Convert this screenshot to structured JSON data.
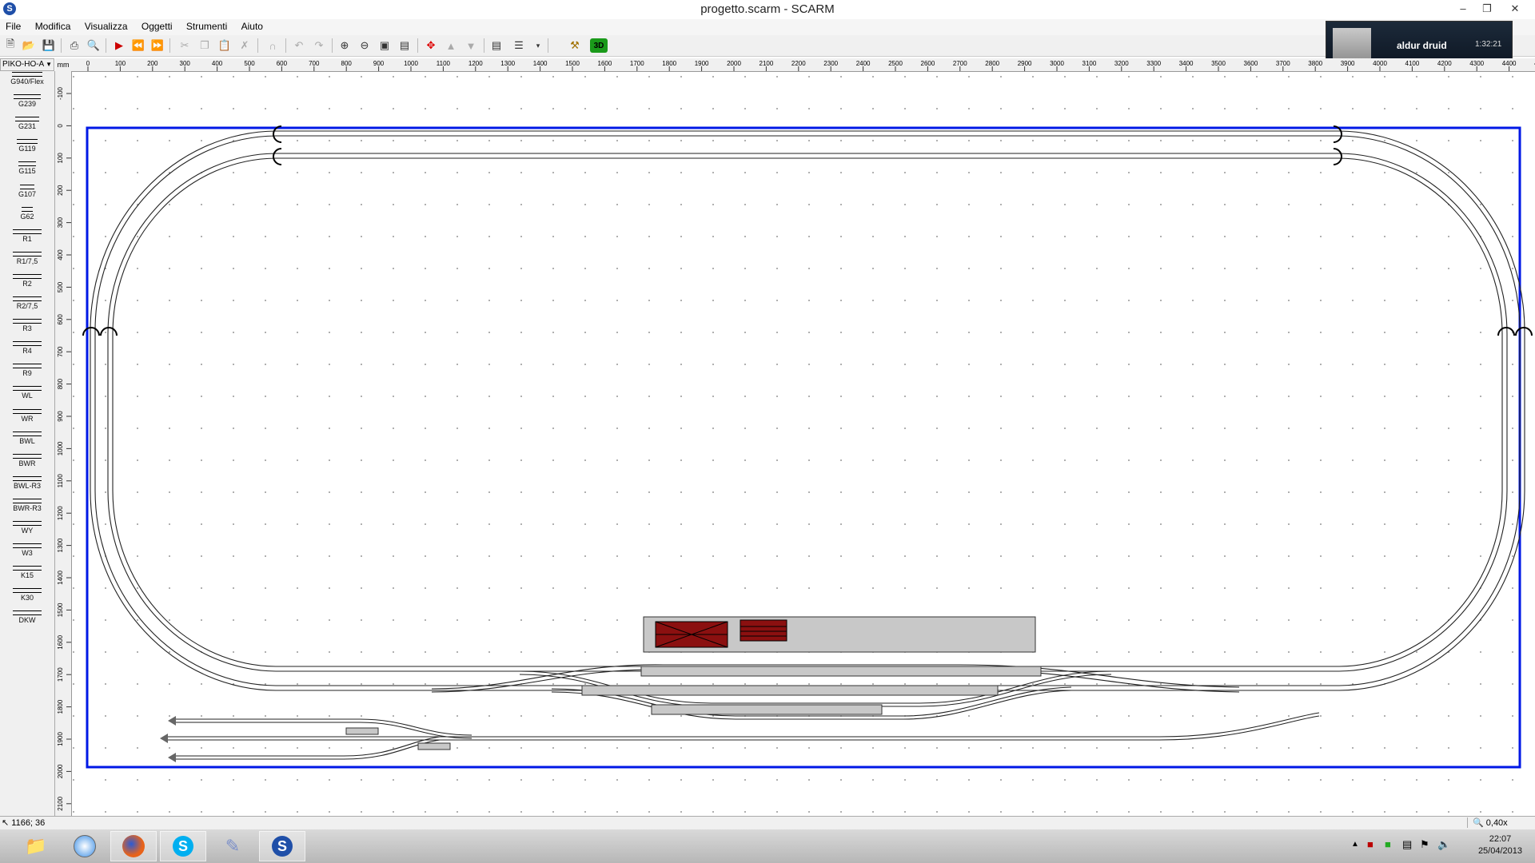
{
  "window": {
    "title": "progetto.scarm - SCARM",
    "app_icon": "S"
  },
  "menu": [
    "File",
    "Modifica",
    "Visualizza",
    "Oggetti",
    "Strumenti",
    "Aiuto"
  ],
  "toolbar_icons": [
    "new-file-icon",
    "open-folder-icon",
    "save-icon",
    "print-icon",
    "print-preview-icon",
    "run-icon",
    "rewind-icon",
    "fast-forward-icon",
    "cut-icon",
    "copy-icon",
    "paste-icon",
    "delete-icon",
    "magnet-icon",
    "undo-icon",
    "redo-icon",
    "zoom-in-icon",
    "zoom-out-icon",
    "zoom-fit-icon",
    "zoom-window-icon",
    "track-flex-icon",
    "bridge-icon",
    "tunnel-icon",
    "level-icon",
    "layers-icon",
    "tools-icon"
  ],
  "toolbar_3d_label": "3D",
  "notification": {
    "name": "aldur druid",
    "time": "1:32:21"
  },
  "library": {
    "selected": "PIKO-HO-A"
  },
  "palette_items": [
    "G940/Flex",
    "G239",
    "G231",
    "G119",
    "G115",
    "G107",
    "G62",
    "R1",
    "R1/7,5",
    "R2",
    "R2/7,5",
    "R3",
    "R4",
    "R9",
    "WL",
    "WR",
    "BWL",
    "BWR",
    "BWL-R3",
    "BWR-R3",
    "WY",
    "W3",
    "K15",
    "K30",
    "DKW"
  ],
  "ruler": {
    "unit": "mm",
    "h_labels": [
      "0",
      "100",
      "200",
      "300",
      "400",
      "500",
      "600",
      "700",
      "800",
      "900",
      "1000",
      "1100",
      "1200",
      "1300",
      "1400",
      "1500",
      "1600",
      "1700",
      "1800",
      "1900",
      "2000",
      "2100",
      "2200",
      "2300",
      "2400",
      "2500",
      "2600",
      "2700",
      "2800",
      "2900",
      "3000",
      "3100",
      "3200",
      "3300",
      "3400",
      "3500",
      "3600",
      "3700",
      "3800",
      "3900",
      "4000",
      "4100",
      "4200",
      "4300",
      "4400",
      "4500"
    ],
    "v_labels": [
      "-100",
      "0",
      "100",
      "200",
      "300",
      "400",
      "500",
      "600",
      "700",
      "800",
      "900",
      "1000",
      "1100",
      "1200",
      "1300",
      "1400",
      "1500",
      "1600",
      "1700",
      "1800",
      "1900",
      "2000",
      "2100"
    ]
  },
  "status": {
    "coords": "1166; 36",
    "zoom": "0,40x"
  },
  "taskbar": {
    "apps": [
      "file-explorer-icon",
      "safari-icon",
      "firefox-icon",
      "skype-icon",
      "paint-icon",
      "scarm-icon"
    ]
  },
  "clock": {
    "time": "22:07",
    "date": "25/04/2013"
  },
  "colors": {
    "board_border": "#0018e6",
    "track": "#222222",
    "building_roof": "#8b1010",
    "platform": "#c8c8c8"
  }
}
